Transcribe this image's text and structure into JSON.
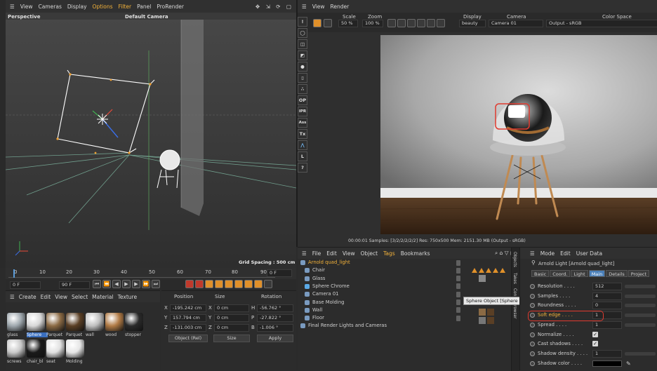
{
  "viewport": {
    "menu": [
      "View",
      "Cameras",
      "Display",
      "Options",
      "Filter",
      "Panel",
      "ProRender"
    ],
    "highlighted_menu": [
      "Options",
      "Filter"
    ],
    "label_left": "Perspective",
    "label_camera": "Default Camera",
    "grid_spacing": "Grid Spacing : 500 cm"
  },
  "timeline": {
    "ticks": [
      "0",
      "10",
      "20",
      "30",
      "40",
      "50",
      "60",
      "70",
      "80",
      "90"
    ],
    "end_field": "0 F",
    "start_field": "0 F",
    "end_frame": "90 F"
  },
  "materials": {
    "menu": [
      "Create",
      "Edit",
      "View",
      "Select",
      "Material",
      "Texture"
    ],
    "row1": [
      {
        "name": "glass",
        "color": "#9ea7ad"
      },
      {
        "name": "Sphere",
        "color": "#d8d8d8"
      },
      {
        "name": "Parquet",
        "color": "#8b6a44"
      },
      {
        "name": "Parquet",
        "color": "#5a3f25"
      },
      {
        "name": "wall",
        "color": "#bfbfbf"
      },
      {
        "name": "wood",
        "color": "#b07a45"
      },
      {
        "name": "stopper",
        "color": "#2a2a2a"
      }
    ],
    "row2": [
      {
        "name": "screws",
        "color": "#c8c8c8"
      },
      {
        "name": "chair_bl",
        "color": "#1a1a1a"
      },
      {
        "name": "seat",
        "color": "#e0e0e0"
      },
      {
        "name": "Molding",
        "color": "#e6e6e6"
      }
    ]
  },
  "coords": {
    "headers": [
      "Position",
      "Size",
      "Rotation"
    ],
    "rows": [
      {
        "axis": "X",
        "pos": "-195.242 cm",
        "saxis": "X",
        "size": "0 cm",
        "raxis": "H",
        "rot": "-56.762 °"
      },
      {
        "axis": "Y",
        "pos": "157.794 cm",
        "saxis": "Y",
        "size": "0 cm",
        "raxis": "P",
        "rot": "-27.822 °"
      },
      {
        "axis": "Z",
        "pos": "-131.003 cm",
        "saxis": "Z",
        "size": "0 cm",
        "raxis": "B",
        "rot": "-1.006 °"
      }
    ],
    "mode": "Object (Rel)",
    "size_mode": "Size",
    "apply": "Apply"
  },
  "render": {
    "menu": [
      "View",
      "Render"
    ],
    "scale_label": "Scale",
    "zoom_label": "Zoom",
    "scale_value": "50 %",
    "zoom_value": "100 %",
    "display_label": "Display",
    "camera_label": "Camera",
    "colorspace_label": "Color Space",
    "display_value": "beauty",
    "camera_value": "Camera 01",
    "colorspace_value": "Output - sRGB",
    "status": "00:00:01  Samples: [3/2/2/2/2/2]  Res: 750x500  Mem: 2151.30 MB  (Output - sRGB)"
  },
  "side_tools": [
    "OP",
    "IPR",
    "Ass",
    "Tx",
    "L",
    "?"
  ],
  "objects": {
    "menu": [
      "File",
      "Edit",
      "View",
      "Object",
      "Tags",
      "Bookmarks"
    ],
    "tags_highlight": "Tags",
    "items": [
      {
        "name": "Arnold quad_light",
        "highlight": true
      },
      {
        "name": "Chair",
        "highlight": false
      },
      {
        "name": "Glass",
        "highlight": false
      },
      {
        "name": "Sphere Chrome",
        "highlight": false
      },
      {
        "name": "Camera 01",
        "highlight": false
      },
      {
        "name": "Base Molding",
        "highlight": false
      },
      {
        "name": "Wall",
        "highlight": false
      },
      {
        "name": "Floor",
        "highlight": false
      },
      {
        "name": "Final Render Lights and Cameras",
        "highlight": false
      }
    ],
    "tooltip": "Sphere Object [Sphere Chrome]",
    "side_tabs": [
      "Objects",
      "Takes",
      "Con",
      "Browser"
    ]
  },
  "attributes": {
    "menu": [
      "Mode",
      "Edit",
      "User Data"
    ],
    "title": "Arnold Light [Arnold quad_light]",
    "tabs": [
      "Basic",
      "Coord.",
      "Light",
      "Main",
      "Details",
      "Project"
    ],
    "active_tab": "Main",
    "rows": [
      {
        "label": "Resolution",
        "value": "512"
      },
      {
        "label": "Samples",
        "value": "4"
      },
      {
        "label": "Roundness",
        "value": "0"
      },
      {
        "label": "Soft edge",
        "value": "1"
      },
      {
        "label": "Spread",
        "value": "1"
      },
      {
        "label": "Normalize",
        "value": ""
      },
      {
        "label": "Cast shadows",
        "value": ""
      },
      {
        "label": "Shadow density",
        "value": "1"
      },
      {
        "label": "Shadow color",
        "value": ""
      }
    ],
    "annotation_color": "#e03a2f"
  }
}
